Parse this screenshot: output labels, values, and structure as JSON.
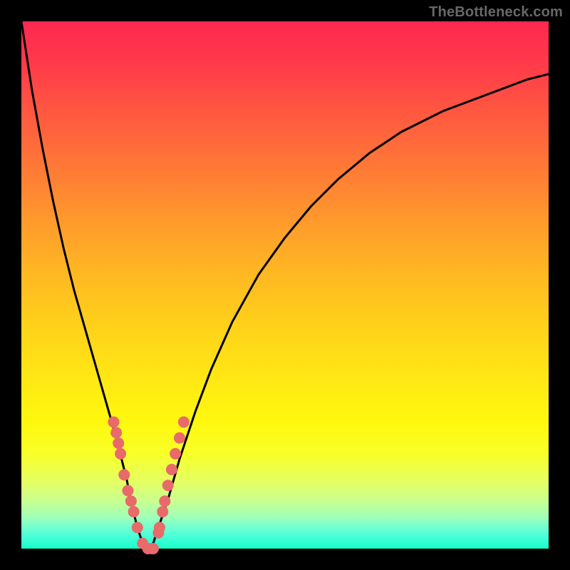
{
  "watermark": "TheBottleneck.com",
  "colors": {
    "frame": "#000000",
    "curve": "#000000",
    "marker": "#e86a6a",
    "gradient_top": "#ff2850",
    "gradient_bottom": "#18ffca"
  },
  "chart_data": {
    "type": "line",
    "title": "",
    "xlabel": "",
    "ylabel": "",
    "xlim": [
      0,
      100
    ],
    "ylim": [
      0,
      100
    ],
    "x": [
      0,
      2,
      4,
      6,
      8,
      10,
      12,
      14,
      16,
      18,
      19,
      20,
      21,
      22,
      23,
      24,
      25,
      26,
      28,
      30,
      33,
      36,
      40,
      45,
      50,
      55,
      60,
      66,
      72,
      80,
      88,
      96,
      100
    ],
    "y": [
      100,
      87,
      76,
      66,
      57,
      49,
      42,
      35,
      28,
      21,
      17,
      13,
      8,
      4,
      1,
      0,
      1,
      4,
      10,
      17,
      26,
      34,
      43,
      52,
      59,
      65,
      70,
      75,
      79,
      83,
      86,
      89,
      90
    ],
    "markers": {
      "x": [
        17.5,
        18.0,
        18.4,
        18.8,
        19.5,
        20.2,
        20.8,
        21.3,
        22.0,
        23.0,
        24.0,
        24.8,
        25.0,
        26.0,
        26.2,
        26.8,
        27.2,
        27.8,
        28.5,
        29.2,
        30.0,
        30.8
      ],
      "y": [
        24,
        22,
        20,
        18,
        14,
        11,
        9,
        7,
        4,
        1,
        0,
        0,
        0,
        3,
        4,
        7,
        9,
        12,
        15,
        18,
        21,
        24
      ]
    }
  }
}
